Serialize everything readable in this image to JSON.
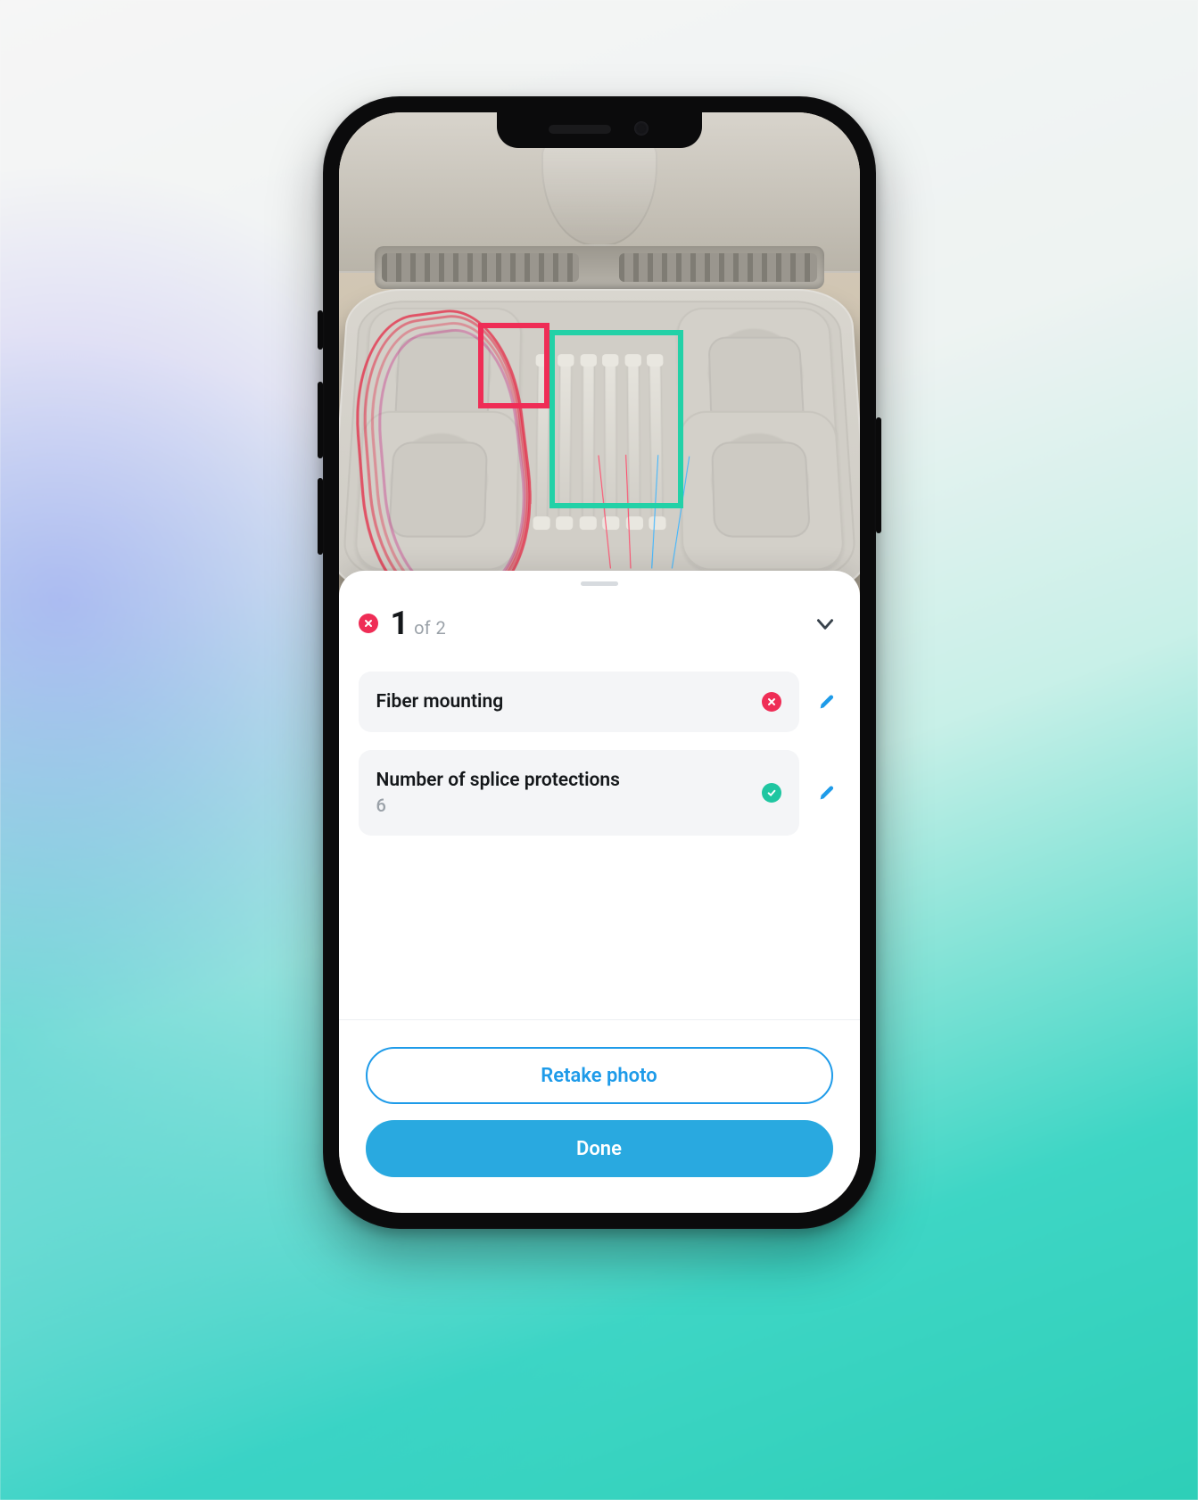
{
  "counter": {
    "current": "1",
    "of_label": "of",
    "total": "2"
  },
  "overall_status": "error",
  "items": [
    {
      "label": "Fiber mounting",
      "value": null,
      "status": "error"
    },
    {
      "label": "Number of splice protections",
      "value": "6",
      "status": "ok"
    }
  ],
  "detections": [
    {
      "status": "error"
    },
    {
      "status": "ok"
    }
  ],
  "buttons": {
    "retake": "Retake photo",
    "done": "Done"
  },
  "colors": {
    "error": "#ef2d56",
    "ok": "#1fc6a1",
    "ok_box": "#23d1a7",
    "primary": "#29a9e0",
    "outline": "#1e9be9"
  }
}
